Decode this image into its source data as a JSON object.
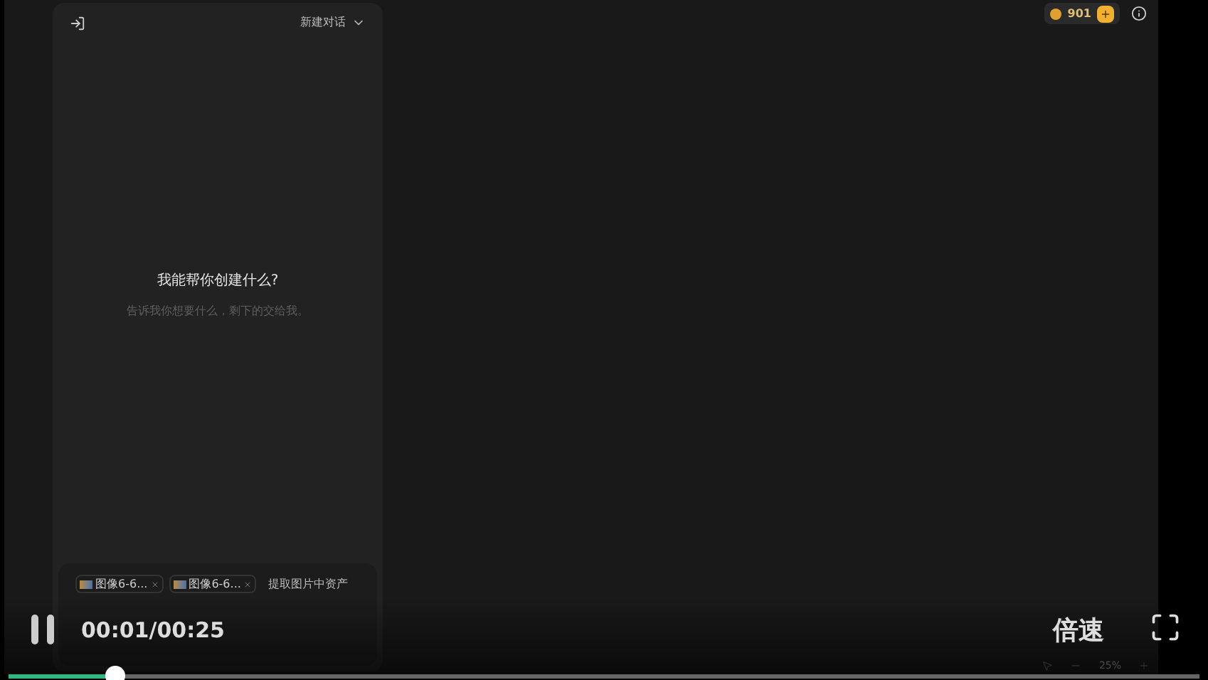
{
  "app": {
    "sidebar": {
      "new_chat": "新建对话",
      "title": "我能帮你创建什么?",
      "subtitle": "告诉我你想要什么，剩下的交给我。",
      "chips": [
        {
          "kind": "image",
          "label": "图像6-6..."
        },
        {
          "kind": "image",
          "label": "图像6-6..."
        },
        {
          "kind": "text",
          "label": "提取图片中资产"
        }
      ]
    },
    "credits": "901",
    "zoom": "25%"
  },
  "player": {
    "playing": true,
    "time": "00:01/00:25",
    "speed": "倍速",
    "progress": {
      "level": 0.09
    }
  }
}
